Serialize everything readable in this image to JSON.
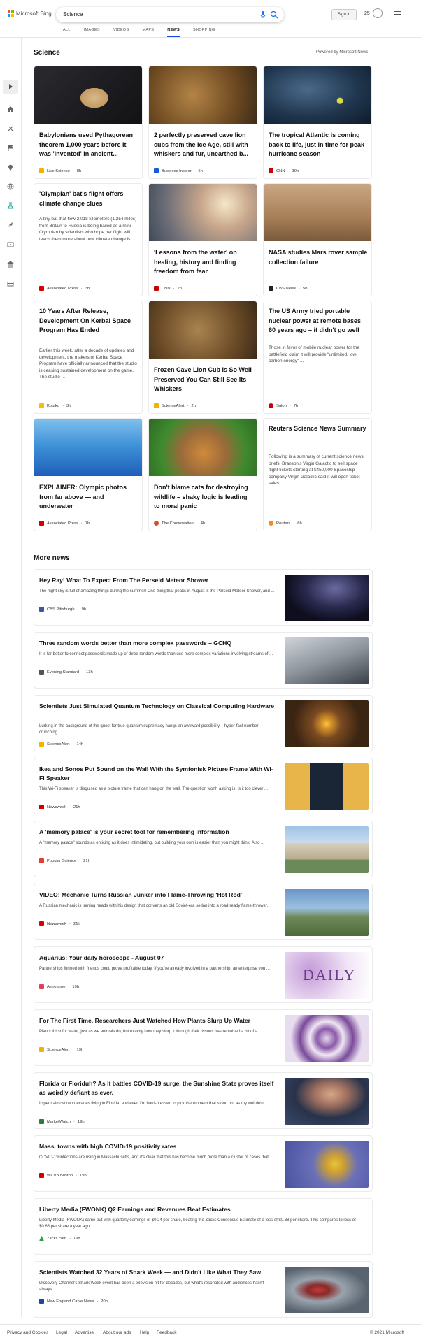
{
  "header": {
    "brand": "Microsoft Bing",
    "search_value": "Science",
    "signin": "Sign in",
    "rewards": "25"
  },
  "tabs": [
    "ALL",
    "IMAGES",
    "VIDEOS",
    "MAPS",
    "NEWS",
    "SHOPPING"
  ],
  "active_tab": "NEWS",
  "section": {
    "title": "Science",
    "powered": "Powered by Microsoft News"
  },
  "cards": [
    {
      "title": "Babylonians used Pythagorean theorem 1,000 years before it was 'invented' in ancient...",
      "source": "Live Science",
      "time": "8h",
      "desc": "",
      "color": "#f2b300"
    },
    {
      "title": "2 perfectly preserved cave lion cubs from the Ice Age, still with whiskers and fur, unearthed b...",
      "source": "Business Insider",
      "time": "5h",
      "desc": "",
      "color": "#1a5ad6"
    },
    {
      "title": "The tropical Atlantic is coming back to life, just in time for peak hurricane season",
      "source": "CNN",
      "time": "10h",
      "desc": "",
      "color": "#cc0000"
    },
    {
      "title": "'Olympian' bat's flight offers climate change clues",
      "source": "Associated Press",
      "time": "3h",
      "desc": "A tiny bat that flew 2,018 kilometers (1,254 miles) from Britain to Russia is being hailed as a mini-Olympian by scientists who hope her flight will teach them more about how climate change is ...",
      "color": "#d40000"
    },
    {
      "title": "'Lessons from the water' on healing, history and finding freedom from fear",
      "source": "CNN",
      "time": "2h",
      "desc": "",
      "color": "#cc0000"
    },
    {
      "title": "NASA studies Mars rover sample collection failure",
      "source": "CBS News",
      "time": "5h",
      "desc": "",
      "color": "#222222"
    },
    {
      "title": "10 Years After Release, Development On Kerbal Space Program Has Ended",
      "source": "Kotaku",
      "time": "3h",
      "desc": "Earlier this week, after a decade of updates and development, the makers of Kerbal Space Program have officially announced that the studio is ceasing sustained development on the game. The studio ...",
      "color": "#f2c200"
    },
    {
      "title": "Frozen Cave Lion Cub Is So Well Preserved You Can Still See Its Whiskers",
      "source": "ScienceAlert",
      "time": "2h",
      "desc": "",
      "color": "#f2b300"
    },
    {
      "title": "The US Army tried portable nuclear power at remote bases 60 years ago – it didn't go well",
      "source": "Salon",
      "time": "7h",
      "desc": "Those in favor of mobile nuclear power for the battlefield claim it will provide \"unlimited, low-carbon energy\" ...",
      "color": "#cc0000"
    },
    {
      "title": "EXPLAINER: Olympic photos from far above — and underwater",
      "source": "Associated Press",
      "time": "7h",
      "desc": "",
      "color": "#d40000"
    },
    {
      "title": "Don't blame cats for destroying wildlife – shaky logic is leading to moral panic",
      "source": "The Conversation",
      "time": "4h",
      "desc": "",
      "color": "#e04b2f"
    },
    {
      "title": "Reuters Science News Summary",
      "source": "Reuters",
      "time": "6h",
      "desc": "Following is a summary of current science news briefs. Branson's Virgin Galactic to sell space flight tickets starting at $450,000 Spaceship company Virgin Galactic said it will open ticket sales ...",
      "color": "#f28c1e"
    }
  ],
  "more_news": {
    "title": "More news",
    "items": [
      {
        "title": "Hey Ray! What To Expect From The Perseid Meteor Shower",
        "desc": "The night sky is full of amazing things during the summer! One thing that peaks in August is the Perseid Meteor Shower, and ...",
        "source": "CBS Pittsburgh",
        "time": "9h",
        "color": "#3b5998"
      },
      {
        "title": "Three random words better than more complex passwords – GCHQ",
        "desc": "It is far better to connect passwords made up of three random words than use more complex variations involving streams of ...",
        "source": "Evening Standard",
        "time": "13h",
        "color": "#555555"
      },
      {
        "title": "Scientists Just Simulated Quantum Technology on Classical Computing Hardware",
        "desc": "Lurking in the background of the quest for true quantum supremacy hangs an awkward possibility – hyper-fast number crunching ...",
        "source": "ScienceAlert",
        "time": "14h",
        "color": "#f2b300"
      },
      {
        "title": "Ikea and Sonos Put Sound on the Wall With the Symfonisk Picture Frame With Wi-Fi Speaker",
        "desc": "This Wi-Fi speaker is disguised as a picture frame that can hang on the wall. The question worth asking is, is it too clever ...",
        "source": "Newsweek",
        "time": "21h",
        "color": "#d40000"
      },
      {
        "title": "A 'memory palace' is your secret tool for remembering information",
        "desc": "A \"memory palace\" sounds as enticing as it does intimidating, but building your own is easier than you might think. Also ...",
        "source": "Popular Science",
        "time": "21h",
        "color": "#e0402f"
      },
      {
        "title": "VIDEO: Mechanic Turns Russian Junker into Flame-Throwing 'Hot Rod'",
        "desc": "A Russian mechanic is turning heads with his design that converts an old Soviet-era sedan into a road-ready flame-thrower.",
        "source": "Newsweek",
        "time": "21h",
        "color": "#d40000"
      },
      {
        "title": "Aquarius: Your daily horoscope - August 07",
        "desc": "Partnerships formed with friends could prove profitable today. If you're already involved in a partnership, an enterprise you ...",
        "source": "Astrofame",
        "time": "19h",
        "color": "#e0405a"
      },
      {
        "title": "For The First Time, Researchers Just Watched How Plants Slurp Up Water",
        "desc": "Plants thirst for water, just as we animals do, but exactly how they slurp it through their tissues has remained a bit of a ...",
        "source": "ScienceAlert",
        "time": "19h",
        "color": "#f2b300"
      },
      {
        "title": "Florida or Floriduh? As it battles COVID-19 surge, the Sunshine State proves itself as weirdly defiant as ever.",
        "desc": "I spent almost two decades living in Florida, and even I'm hard-pressed to pick the moment that stood out as my weirdest.",
        "source": "MarketWatch",
        "time": "19h",
        "color": "#2c7d3d"
      },
      {
        "title": "Mass. towns with high COVID-19 positivity rates",
        "desc": "COVID-19 infections are rising in Massachusetts, and it's clear that this has become much more than a cluster of cases that ...",
        "source": "WCVB Boston",
        "time": "19h",
        "color": "#d40000"
      },
      {
        "title": "Liberty Media (FWONK) Q2 Earnings and Revenues Beat Estimates",
        "desc": "Liberty Media (FWONK) came out with quarterly earnings of $0.24 per share, beating the Zacks Consensus Estimate of a loss of $0.38 per share. This compares to loss of $0.66 per share a year ago.",
        "source": "Zacks.com",
        "time": "19h",
        "color": "#2ea043"
      },
      {
        "title": "Scientists Watched 32 Years of Shark Week — and Didn't Like What They Saw",
        "desc": "Discovery Channel's Shark Week event has been a television hit for decades, but what's resonated with audiences hasn't always ...",
        "source": "New England Cable News",
        "time": "20h",
        "color": "#1a4aa0"
      }
    ]
  },
  "horoscope_image_text": "DAILY",
  "footer": {
    "links": [
      "Privacy and Cookies",
      "Legal",
      "Advertise",
      "About our ads",
      "Help",
      "Feedback"
    ],
    "copyright": "© 2021 Microsoft"
  }
}
